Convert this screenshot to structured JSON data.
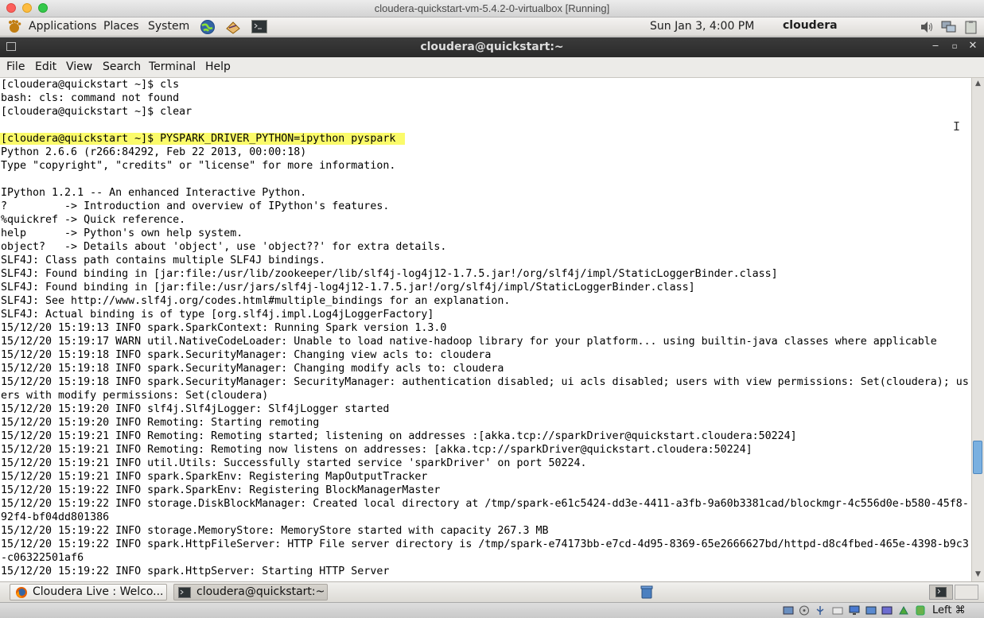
{
  "host_window": {
    "title": "cloudera-quickstart-vm-5.4.2-0-virtualbox [Running]"
  },
  "top_panel": {
    "menus": [
      "Applications",
      "Places",
      "System"
    ],
    "clock": "Sun Jan  3,  4:00 PM",
    "user": "cloudera"
  },
  "terminal": {
    "title": "cloudera@quickstart:~",
    "menu": [
      "File",
      "Edit",
      "View",
      "Search",
      "Terminal",
      "Help"
    ],
    "highlighted_command": "[cloudera@quickstart ~]$ PYSPARK_DRIVER_PYTHON=ipython pyspark",
    "lines": [
      "[cloudera@quickstart ~]$ cls",
      "bash: cls: command not found",
      "[cloudera@quickstart ~]$ clear",
      "",
      "",
      "Python 2.6.6 (r266:84292, Feb 22 2013, 00:00:18)",
      "Type \"copyright\", \"credits\" or \"license\" for more information.",
      "",
      "IPython 1.2.1 -- An enhanced Interactive Python.",
      "?         -> Introduction and overview of IPython's features.",
      "%quickref -> Quick reference.",
      "help      -> Python's own help system.",
      "object?   -> Details about 'object', use 'object??' for extra details.",
      "SLF4J: Class path contains multiple SLF4J bindings.",
      "SLF4J: Found binding in [jar:file:/usr/lib/zookeeper/lib/slf4j-log4j12-1.7.5.jar!/org/slf4j/impl/StaticLoggerBinder.class]",
      "SLF4J: Found binding in [jar:file:/usr/jars/slf4j-log4j12-1.7.5.jar!/org/slf4j/impl/StaticLoggerBinder.class]",
      "SLF4J: See http://www.slf4j.org/codes.html#multiple_bindings for an explanation.",
      "SLF4J: Actual binding is of type [org.slf4j.impl.Log4jLoggerFactory]",
      "15/12/20 15:19:13 INFO spark.SparkContext: Running Spark version 1.3.0",
      "15/12/20 15:19:17 WARN util.NativeCodeLoader: Unable to load native-hadoop library for your platform... using builtin-java classes where applicable",
      "15/12/20 15:19:18 INFO spark.SecurityManager: Changing view acls to: cloudera",
      "15/12/20 15:19:18 INFO spark.SecurityManager: Changing modify acls to: cloudera",
      "15/12/20 15:19:18 INFO spark.SecurityManager: SecurityManager: authentication disabled; ui acls disabled; users with view permissions: Set(cloudera); us",
      "ers with modify permissions: Set(cloudera)",
      "15/12/20 15:19:20 INFO slf4j.Slf4jLogger: Slf4jLogger started",
      "15/12/20 15:19:20 INFO Remoting: Starting remoting",
      "15/12/20 15:19:21 INFO Remoting: Remoting started; listening on addresses :[akka.tcp://sparkDriver@quickstart.cloudera:50224]",
      "15/12/20 15:19:21 INFO Remoting: Remoting now listens on addresses: [akka.tcp://sparkDriver@quickstart.cloudera:50224]",
      "15/12/20 15:19:21 INFO util.Utils: Successfully started service 'sparkDriver' on port 50224.",
      "15/12/20 15:19:21 INFO spark.SparkEnv: Registering MapOutputTracker",
      "15/12/20 15:19:22 INFO spark.SparkEnv: Registering BlockManagerMaster",
      "15/12/20 15:19:22 INFO storage.DiskBlockManager: Created local directory at /tmp/spark-e61c5424-dd3e-4411-a3fb-9a60b3381cad/blockmgr-4c556d0e-b580-45f8-",
      "92f4-bf04dd801386",
      "15/12/20 15:19:22 INFO storage.MemoryStore: MemoryStore started with capacity 267.3 MB",
      "15/12/20 15:19:22 INFO spark.HttpFileServer: HTTP File server directory is /tmp/spark-e74173bb-e7cd-4d95-8369-65e2666627bd/httpd-d8c4fbed-465e-4398-b9c3",
      "-c06322501af6",
      "15/12/20 15:19:22 INFO spark.HttpServer: Starting HTTP Server"
    ]
  },
  "taskbar": {
    "items": [
      "Cloudera Live : Welco...",
      "cloudera@quickstart:~"
    ]
  },
  "status_bar": {
    "host_key": "Left ⌘"
  },
  "colors": {
    "highlight": "#fbfb6a",
    "scroll_thumb": "#7ab0e0"
  }
}
